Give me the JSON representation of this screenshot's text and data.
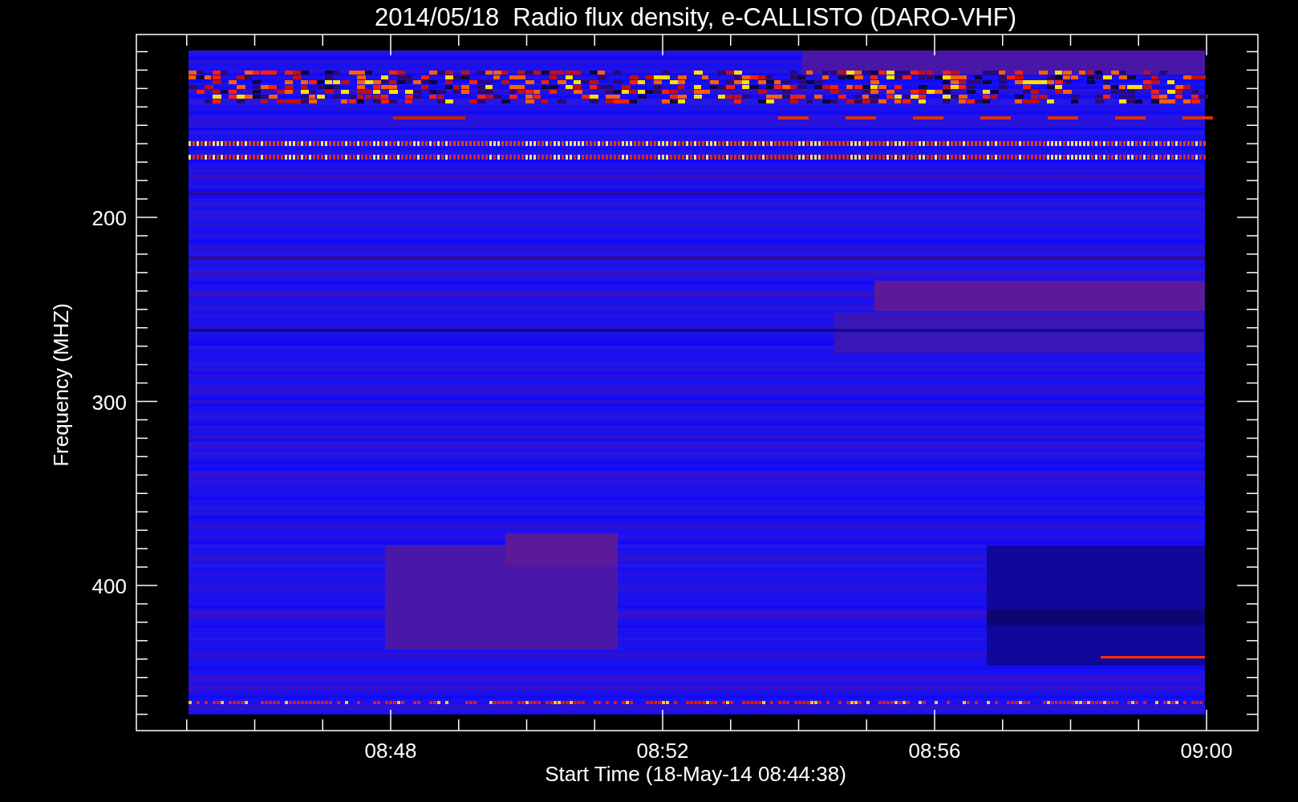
{
  "title": "2014/05/18  Radio flux density, e-CALLISTO (DARO-VHF)",
  "plot": {
    "ylabel": "Frequency (MHZ)",
    "xlabel": "Start Time (18-May-14 08:44:38)",
    "yticks": [
      {
        "label": "200"
      },
      {
        "label": "300"
      },
      {
        "label": "400"
      }
    ],
    "xticks": [
      {
        "label": "08:48"
      },
      {
        "label": "08:52"
      },
      {
        "label": "08:56"
      },
      {
        "label": "09:00"
      }
    ]
  }
}
